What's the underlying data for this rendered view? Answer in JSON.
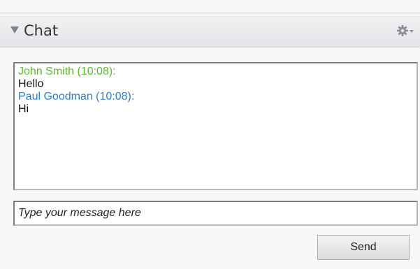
{
  "header": {
    "title": "Chat",
    "collapse_icon": "triangle-down-icon",
    "settings_icon": "gear-icon"
  },
  "messages": [
    {
      "author": "John Smith (10:08):",
      "text": "Hello",
      "color": "#5cb82b"
    },
    {
      "author": "Paul Goodman (10:08):",
      "text": "Hi",
      "color": "#2a7fd8"
    }
  ],
  "composer": {
    "placeholder": "Type your message here",
    "value": ""
  },
  "send_button": {
    "label": "Send"
  }
}
